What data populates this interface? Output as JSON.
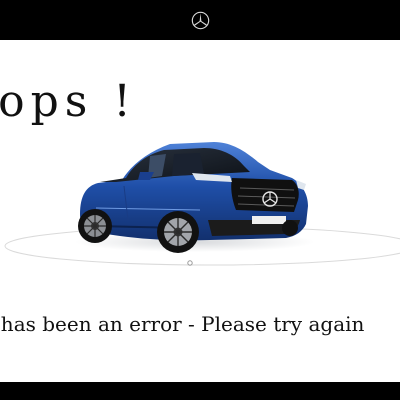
{
  "header": {
    "logo_icon": "mercedes-star-icon"
  },
  "main": {
    "heading": "Oops !",
    "image_icon": "electric-suv-car-image",
    "car_color": "#1f4fa8",
    "error_message": "There has been an error - Please try again"
  }
}
